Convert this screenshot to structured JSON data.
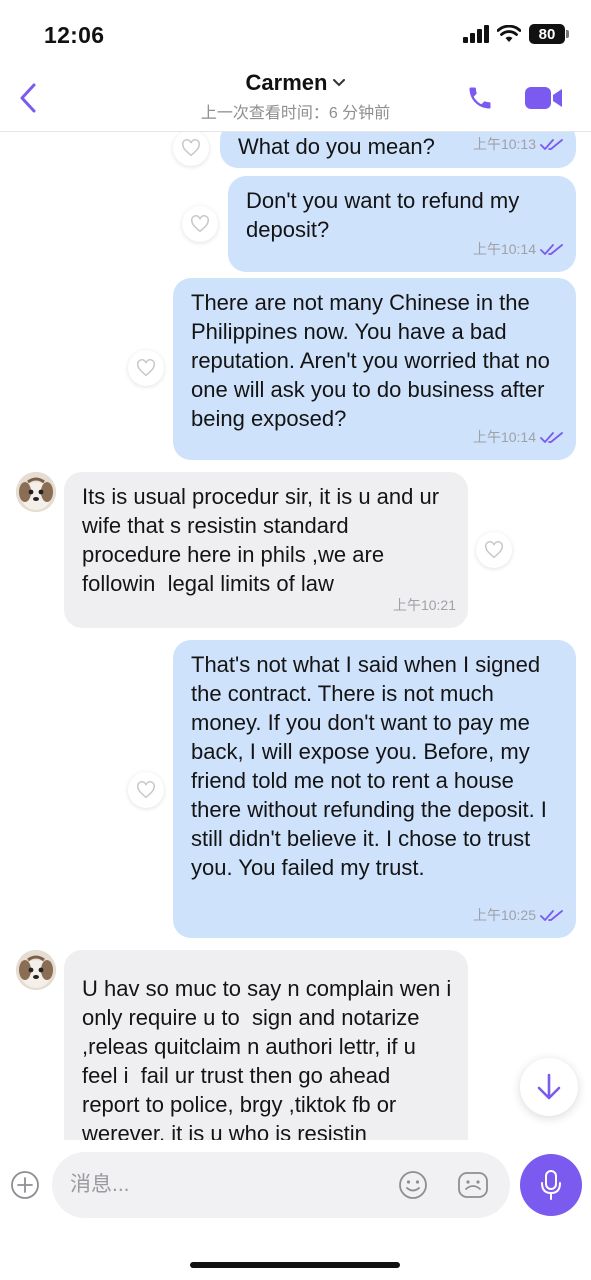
{
  "status_bar": {
    "time": "12:06",
    "battery": "80"
  },
  "header": {
    "contact_name": "Carmen",
    "last_seen": "上一次查看时间：6 分钟前",
    "accent_color": "#7b5af0"
  },
  "messages": [
    {
      "direction": "out",
      "text": "What do you mean?",
      "time": "上午10:13",
      "read": true
    },
    {
      "direction": "out",
      "text": "Don't you want to refund my deposit?",
      "time": "上午10:14",
      "read": true
    },
    {
      "direction": "out",
      "text": "There are not many Chinese in the Philippines now. You have a bad reputation. Aren't you worried that no one will ask you to do business after being exposed?",
      "time": "上午10:14",
      "read": true
    },
    {
      "direction": "in",
      "text": "Its is usual procedur sir, it is u and ur wife that s resistin standard procedure here in phils ,we are followin  legal limits of law",
      "time": "上午10:21"
    },
    {
      "direction": "out",
      "text": "That's not what I said when I signed the contract. There is not much money. If you don't want to pay me back, I will expose you. Before, my friend told me not to rent a house there without refunding the deposit. I still didn't believe it. I chose to trust you. You failed my trust.",
      "time": "上午10:25",
      "read": true
    },
    {
      "direction": "in",
      "text": "U hav so muc to say n complain wen i only require u to  sign and notarize ,releas quitclaim n authori lettr, if u feel i  fail ur trust then go ahead report to police, brgy ,tiktok fb or werever. it is u who is resistin"
    }
  ],
  "composer": {
    "placeholder": "消息..."
  }
}
